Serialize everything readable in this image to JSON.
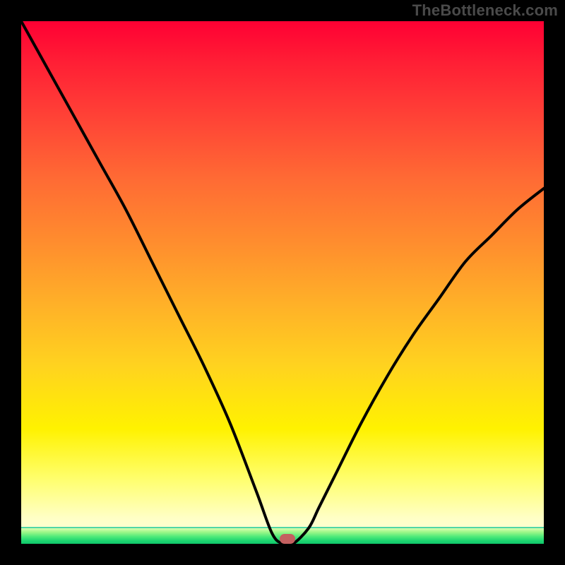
{
  "watermark": "TheBottleneck.com",
  "chart_data": {
    "type": "line",
    "title": "",
    "xlabel": "",
    "ylabel": "",
    "xlim": [
      0,
      100
    ],
    "ylim": [
      0,
      100
    ],
    "grid": false,
    "background_gradient": {
      "orientation": "vertical",
      "stops": [
        {
          "pos": 0.0,
          "color": "#ff0033"
        },
        {
          "pos": 0.3,
          "color": "#ff6a34"
        },
        {
          "pos": 0.6,
          "color": "#ffc81f"
        },
        {
          "pos": 0.85,
          "color": "#ffff72"
        },
        {
          "pos": 0.97,
          "color": "#7ef082"
        },
        {
          "pos": 1.0,
          "color": "#0fc66a"
        }
      ]
    },
    "series": [
      {
        "name": "bottleneck-curve",
        "color": "#000000",
        "x": [
          0,
          5,
          10,
          15,
          20,
          25,
          30,
          35,
          40,
          45,
          48,
          50,
          52,
          55,
          57,
          60,
          65,
          70,
          75,
          80,
          85,
          90,
          95,
          100
        ],
        "y": [
          100,
          91,
          82,
          73,
          64,
          54,
          44,
          34,
          23,
          10,
          2,
          0,
          0,
          3,
          7,
          13,
          23,
          32,
          40,
          47,
          54,
          59,
          64,
          68
        ]
      }
    ],
    "marker": {
      "name": "optimal-point",
      "x": 51,
      "y": 1,
      "color": "#c46060"
    }
  }
}
